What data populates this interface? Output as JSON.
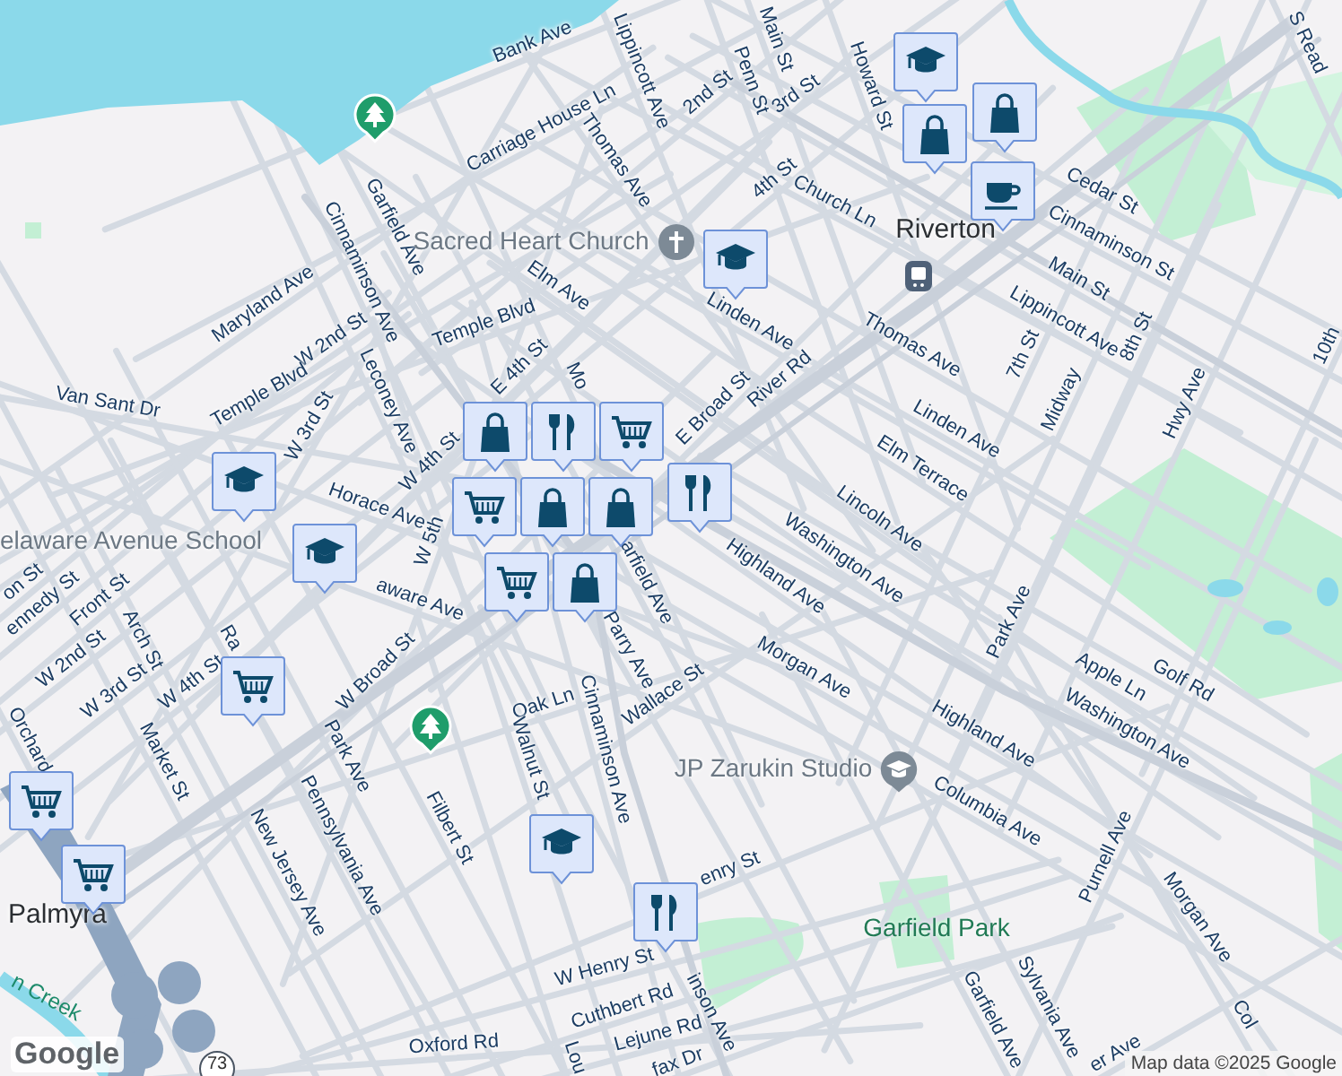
{
  "map": {
    "labels": [
      {
        "text": "Bank Ave",
        "kind": "street"
      },
      {
        "text": "Lippincott Ave",
        "kind": "street"
      },
      {
        "text": "Main St",
        "kind": "street"
      },
      {
        "text": "Penn St",
        "kind": "street"
      },
      {
        "text": "Howard St",
        "kind": "street"
      },
      {
        "text": "S Read",
        "kind": "street"
      },
      {
        "text": "2nd St",
        "kind": "street"
      },
      {
        "text": "3rd St",
        "kind": "street"
      },
      {
        "text": "Carriage House Ln",
        "kind": "street"
      },
      {
        "text": "Thomas Ave",
        "kind": "street"
      },
      {
        "text": "4th St",
        "kind": "street"
      },
      {
        "text": "Church Ln",
        "kind": "street"
      },
      {
        "text": "Cedar St",
        "kind": "street"
      },
      {
        "text": "Garfield Ave",
        "kind": "street"
      },
      {
        "text": "Cinnaminson Ave",
        "kind": "street"
      },
      {
        "text": "Sacred Heart Church",
        "kind": "poi"
      },
      {
        "text": "Riverton",
        "kind": "town"
      },
      {
        "text": "Cinnaminson St",
        "kind": "street"
      },
      {
        "text": "Elm Ave",
        "kind": "street"
      },
      {
        "text": "Maryland Ave",
        "kind": "street"
      },
      {
        "text": "Linden Ave",
        "kind": "street"
      },
      {
        "text": "Main St",
        "kind": "street"
      },
      {
        "text": "Temple Blvd",
        "kind": "street"
      },
      {
        "text": "W 2nd St",
        "kind": "street"
      },
      {
        "text": "Thomas Ave",
        "kind": "street"
      },
      {
        "text": "Lippincott Ave",
        "kind": "street"
      },
      {
        "text": "E 4th St",
        "kind": "street"
      },
      {
        "text": "Leconey Ave",
        "kind": "street"
      },
      {
        "text": "Mo",
        "kind": "street"
      },
      {
        "text": "River Rd",
        "kind": "street"
      },
      {
        "text": "7th St",
        "kind": "street"
      },
      {
        "text": "8th St",
        "kind": "street"
      },
      {
        "text": "Hwy Ave",
        "kind": "street"
      },
      {
        "text": "10th",
        "kind": "street"
      },
      {
        "text": "Van Sant Dr",
        "kind": "street"
      },
      {
        "text": "Temple Blvd",
        "kind": "street"
      },
      {
        "text": "E Broad St",
        "kind": "street"
      },
      {
        "text": "Linden Ave",
        "kind": "street"
      },
      {
        "text": "Midway",
        "kind": "street"
      },
      {
        "text": "W 3rd St",
        "kind": "street"
      },
      {
        "text": "W 4th St",
        "kind": "street"
      },
      {
        "text": "Elm Terrace",
        "kind": "street"
      },
      {
        "text": "Horace Ave",
        "kind": "street"
      },
      {
        "text": "Lincoln Ave",
        "kind": "street"
      },
      {
        "text": "elaware Avenue School",
        "kind": "poi"
      },
      {
        "text": "W 5th",
        "kind": "street"
      },
      {
        "text": "Highland Ave",
        "kind": "street"
      },
      {
        "text": "Washington Ave",
        "kind": "street"
      },
      {
        "text": "on St",
        "kind": "street"
      },
      {
        "text": "aware Ave",
        "kind": "street"
      },
      {
        "text": "arfield Ave",
        "kind": "street"
      },
      {
        "text": "ennedy St",
        "kind": "street"
      },
      {
        "text": "Front St",
        "kind": "street"
      },
      {
        "text": "Park Ave",
        "kind": "street"
      },
      {
        "text": "Parry Ave",
        "kind": "street"
      },
      {
        "text": "Arch St",
        "kind": "street"
      },
      {
        "text": "W 2nd St",
        "kind": "street"
      },
      {
        "text": "Morgan Ave",
        "kind": "street"
      },
      {
        "text": "W 4th St",
        "kind": "street"
      },
      {
        "text": "Ra",
        "kind": "street"
      },
      {
        "text": "Apple Ln",
        "kind": "street"
      },
      {
        "text": "Golf Rd",
        "kind": "street"
      },
      {
        "text": "W 3rd St",
        "kind": "street"
      },
      {
        "text": "W Broad St",
        "kind": "street"
      },
      {
        "text": "Wallace St",
        "kind": "street"
      },
      {
        "text": "Oak Ln",
        "kind": "street"
      },
      {
        "text": "Highland Ave",
        "kind": "street"
      },
      {
        "text": "Washington Ave",
        "kind": "street"
      },
      {
        "text": "Orchard",
        "kind": "street"
      },
      {
        "text": "Park Ave",
        "kind": "street"
      },
      {
        "text": "Cinnaminson Ave",
        "kind": "street"
      },
      {
        "text": "Market St",
        "kind": "street"
      },
      {
        "text": "Walnut St",
        "kind": "street"
      },
      {
        "text": "JP Zarukin Studio",
        "kind": "poi"
      },
      {
        "text": "Columbia Ave",
        "kind": "street"
      },
      {
        "text": "Filbert St",
        "kind": "street"
      },
      {
        "text": "Pennsylvania Ave",
        "kind": "street"
      },
      {
        "text": "Purnell Ave",
        "kind": "street"
      },
      {
        "text": "New Jersey Ave",
        "kind": "street"
      },
      {
        "text": "enry St",
        "kind": "street"
      },
      {
        "text": "Palmyra",
        "kind": "town"
      },
      {
        "text": "Morgan Ave",
        "kind": "street"
      },
      {
        "text": "Garfield Park",
        "kind": "park"
      },
      {
        "text": "W Henry St",
        "kind": "street"
      },
      {
        "text": "Sylvania Ave",
        "kind": "street"
      },
      {
        "text": "n Creek",
        "kind": "water"
      },
      {
        "text": "Cuthbert Rd",
        "kind": "street"
      },
      {
        "text": "Garfield Ave",
        "kind": "street"
      },
      {
        "text": "inson Ave",
        "kind": "street"
      },
      {
        "text": "Lejune Rd",
        "kind": "street"
      },
      {
        "text": "Oxford Rd",
        "kind": "street"
      },
      {
        "text": "er Ave",
        "kind": "street"
      },
      {
        "text": "Col",
        "kind": "street"
      },
      {
        "text": "Lou",
        "kind": "street"
      },
      {
        "text": "fax Dr",
        "kind": "street"
      }
    ],
    "markers": [
      {
        "kind": "park"
      },
      {
        "kind": "park"
      },
      {
        "kind": "church"
      },
      {
        "kind": "transit"
      },
      {
        "kind": "school-poi"
      },
      {
        "kind": "school"
      },
      {
        "kind": "bag"
      },
      {
        "kind": "bag"
      },
      {
        "kind": "cafe"
      },
      {
        "kind": "school"
      },
      {
        "kind": "bag"
      },
      {
        "kind": "cart"
      },
      {
        "kind": "food"
      },
      {
        "kind": "bag"
      },
      {
        "kind": "cart"
      },
      {
        "kind": "bag"
      },
      {
        "kind": "cart"
      },
      {
        "kind": "bag"
      },
      {
        "kind": "school"
      },
      {
        "kind": "school"
      },
      {
        "kind": "cart"
      },
      {
        "kind": "cart"
      },
      {
        "kind": "cart"
      },
      {
        "kind": "school"
      },
      {
        "kind": "food"
      },
      {
        "kind": "food"
      }
    ],
    "route_shield": "73",
    "logo": "Google",
    "attribution": "Map data ©2025 Google"
  }
}
